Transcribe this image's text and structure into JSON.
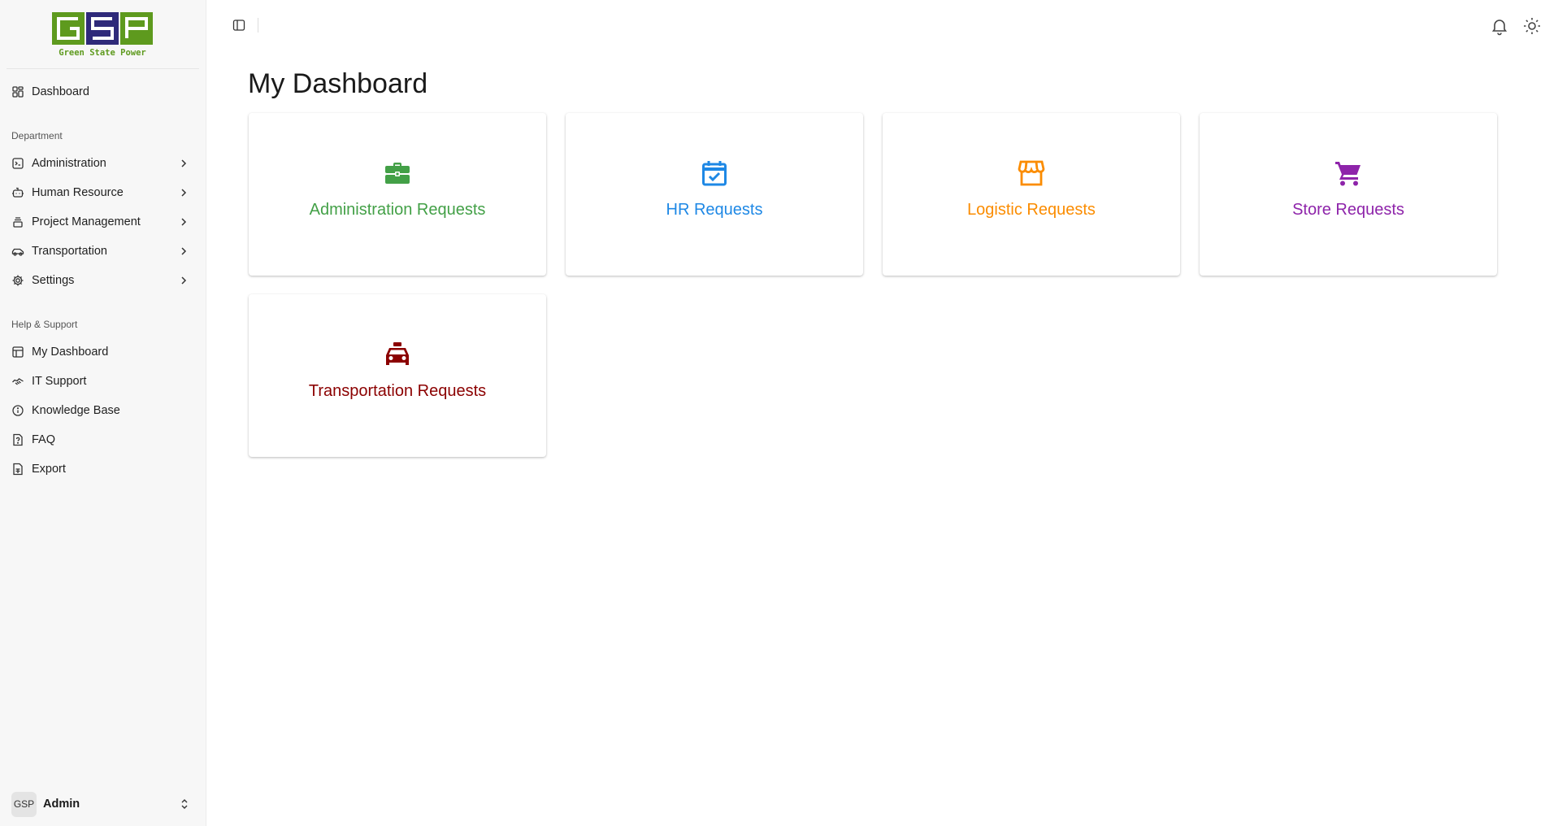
{
  "logo": {
    "letters": [
      "G",
      "S",
      "P"
    ],
    "tagline": "Green State Power",
    "colors": {
      "green": "#5e9a1e",
      "blue": "#2f2a7a"
    }
  },
  "sidebar": {
    "top_item": {
      "label": "Dashboard",
      "icon": "grid-icon"
    },
    "department_label": "Department",
    "department_items": [
      {
        "label": "Administration",
        "icon": "terminal-square-icon"
      },
      {
        "label": "Human Resource",
        "icon": "bot-icon"
      },
      {
        "label": "Project Management",
        "icon": "layers-icon"
      },
      {
        "label": "Transportation",
        "icon": "car-icon"
      },
      {
        "label": "Settings",
        "icon": "gear-icon"
      }
    ],
    "help_label": "Help & Support",
    "help_items": [
      {
        "label": "My Dashboard",
        "icon": "layout-icon"
      },
      {
        "label": "IT Support",
        "icon": "handshake-icon"
      },
      {
        "label": "Knowledge Base",
        "icon": "info-icon"
      },
      {
        "label": "FAQ",
        "icon": "file-question-icon"
      },
      {
        "label": "Export",
        "icon": "file-spreadsheet-icon"
      }
    ]
  },
  "user": {
    "avatar_text": "GSP",
    "name": "Admin"
  },
  "header": {
    "icons": [
      "sidebar-toggle-icon",
      "bell-icon",
      "sun-icon"
    ]
  },
  "main": {
    "title": "My Dashboard",
    "cards": [
      {
        "label": "Administration Requests",
        "icon": "briefcase-icon",
        "color": "#43a047"
      },
      {
        "label": "HR Requests",
        "icon": "calendar-check-icon",
        "color": "#1e88e5"
      },
      {
        "label": "Logistic Requests",
        "icon": "store-icon",
        "color": "#fb8c00"
      },
      {
        "label": "Store Requests",
        "icon": "cart-icon",
        "color": "#8e24aa"
      },
      {
        "label": "Transportation Requests",
        "icon": "taxi-icon",
        "color": "#8b0000"
      }
    ]
  }
}
